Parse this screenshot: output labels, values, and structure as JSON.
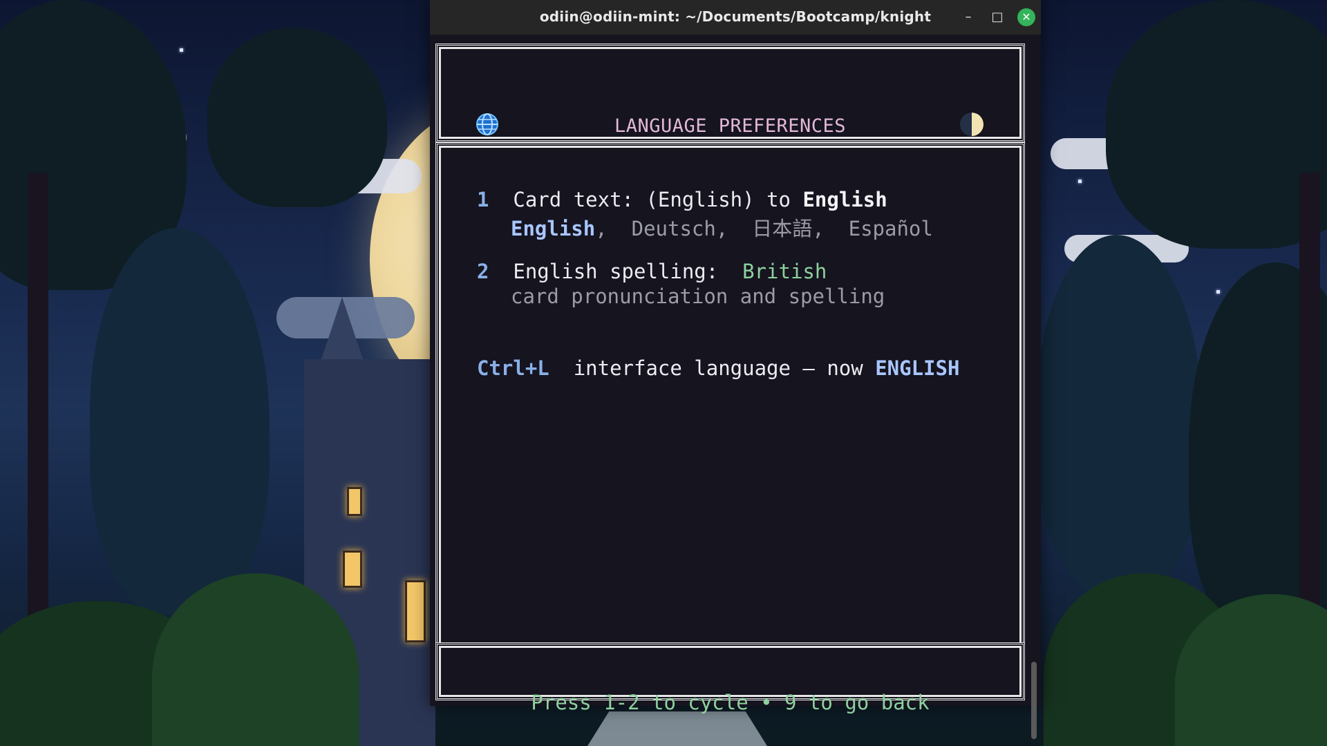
{
  "window": {
    "title": "odiin@odiin-mint: ~/Documents/Bootcamp/knight",
    "minimize_glyph": "–",
    "maximize_glyph": "□",
    "close_glyph": "✕"
  },
  "header": {
    "left_icon": "globe-icon",
    "right_icon": "half-moon-icon",
    "title": "LANGUAGE PREFERENCES"
  },
  "settings": [
    {
      "number": "1",
      "label": "Card text:",
      "value_prefix": "(English) to",
      "value": "English",
      "options": [
        "English",
        "Deutsch",
        "日本語",
        "Español"
      ],
      "selected": "English"
    },
    {
      "number": "2",
      "label": "English spelling:",
      "value": "British",
      "description": "card pronunciation and spelling"
    }
  ],
  "shortcut": {
    "key": "Ctrl+L",
    "label": "interface language – now",
    "value": "ENGLISH"
  },
  "footer": {
    "hint": "Press 1-2 to cycle • 9 to go back"
  },
  "colors": {
    "title_pink": "#e3b8d8",
    "accent_blue": "#a9c6ff",
    "accent_green": "#8fd19e",
    "terminal_bg": "#15141f"
  }
}
